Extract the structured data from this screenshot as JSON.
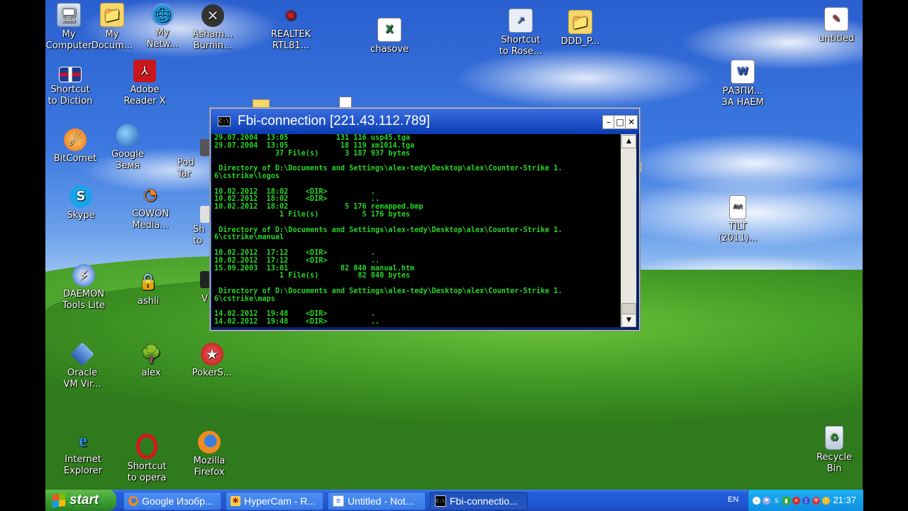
{
  "desktop_icons": [
    {
      "label": "My\nComputer",
      "icon": "my-computer-icon"
    },
    {
      "label": "My\nDocum...",
      "icon": "folder-icon"
    },
    {
      "label": "My\nNetw...",
      "icon": "network-icon"
    },
    {
      "label": "Asham...\nBurnin...",
      "icon": "burning-app-icon"
    },
    {
      "label": "REALTEK\nRTL81...",
      "icon": "realtek-icon"
    },
    {
      "label": "chasove",
      "icon": "excel-icon"
    },
    {
      "label": "Shortcut\nto Rose...",
      "icon": "shortcut-icon"
    },
    {
      "label": "DDD_P...",
      "icon": "folder-icon"
    },
    {
      "label": "untitled",
      "icon": "paint-icon"
    },
    {
      "label": "Shortcut\nto Diction",
      "icon": "uk-flag-icon"
    },
    {
      "label": "Adobe\nReader X",
      "icon": "adobe-reader-icon"
    },
    {
      "label": "РАЗПИ...\nЗА НАЕМ",
      "icon": "word-doc-icon"
    },
    {
      "label": "BitComet",
      "icon": "bitcomet-icon"
    },
    {
      "label": "Google\nЗемя",
      "icon": "google-earth-icon"
    },
    {
      "label": "Skype",
      "icon": "skype-icon"
    },
    {
      "label": "COWON\nMedia...",
      "icon": "cowon-icon"
    },
    {
      "label": "TILT\n(2011)...",
      "icon": "avi-file-icon"
    },
    {
      "label": "DAEMON\nTools Lite",
      "icon": "daemon-tools-icon"
    },
    {
      "label": "ashli",
      "icon": "lock-icon"
    },
    {
      "label": "Oracle\nVM Vir...",
      "icon": "virtualbox-icon"
    },
    {
      "label": "alex",
      "icon": "tree-icon"
    },
    {
      "label": "PokerS...",
      "icon": "pokerstars-icon"
    },
    {
      "label": "Internet\nExplorer",
      "icon": "ie-icon"
    },
    {
      "label": "Shortcut\nto opera",
      "icon": "opera-icon"
    },
    {
      "label": "Mozilla\nFirefox",
      "icon": "firefox-icon"
    },
    {
      "label": "Recycle\nBin",
      "icon": "recycle-bin-icon"
    }
  ],
  "partial_labels": [
    "Pod\nTar",
    "Sh\nto",
    "V",
    "er"
  ],
  "console": {
    "title": "Fbi-connection [221.43.112.789]",
    "icon_text": "C:\\",
    "lines": [
      "29.07.2004  13:05           131 116 usp45.tga",
      "29.07.2004  13:05            18 119 xm1014.tga",
      "              37 File(s)      3 187 937 bytes",
      "",
      " Directory of D:\\Documents and Settings\\alex-tedy\\Desktop\\alex\\Counter-Strike 1.",
      "6\\cstrike\\logos",
      "",
      "10.02.2012  18:02    <DIR>          .",
      "10.02.2012  18:02    <DIR>          ..",
      "10.02.2012  18:02             5 176 remapped.bmp",
      "               1 File(s)          5 176 bytes",
      "",
      " Directory of D:\\Documents and Settings\\alex-tedy\\Desktop\\alex\\Counter-Strike 1.",
      "6\\cstrike\\manual",
      "",
      "10.02.2012  17:12    <DIR>          .",
      "10.02.2012  17:12    <DIR>          ..",
      "15.09.2003  13:01            82 840 manual.htm",
      "               1 File(s)         82 840 bytes",
      "",
      " Directory of D:\\Documents and Settings\\alex-tedy\\Desktop\\alex\\Counter-Strike 1.",
      "6\\cstrike\\maps",
      "",
      "14.02.2012  19:48    <DIR>          .",
      "14.02.2012  19:48    <DIR>          .."
    ]
  },
  "taskbar": {
    "start_label": "start",
    "buttons": [
      {
        "label": "Google Изобр...",
        "icon": "firefox-icon",
        "active": false
      },
      {
        "label": "HyperCam - R...",
        "icon": "hypercam-icon",
        "active": false
      },
      {
        "label": "Untitled - Not...",
        "icon": "notepad-icon",
        "active": false
      },
      {
        "label": "Fbi-connectio...",
        "icon": "console-icon",
        "active": true
      }
    ],
    "language": "EN",
    "clock": "21:37"
  }
}
